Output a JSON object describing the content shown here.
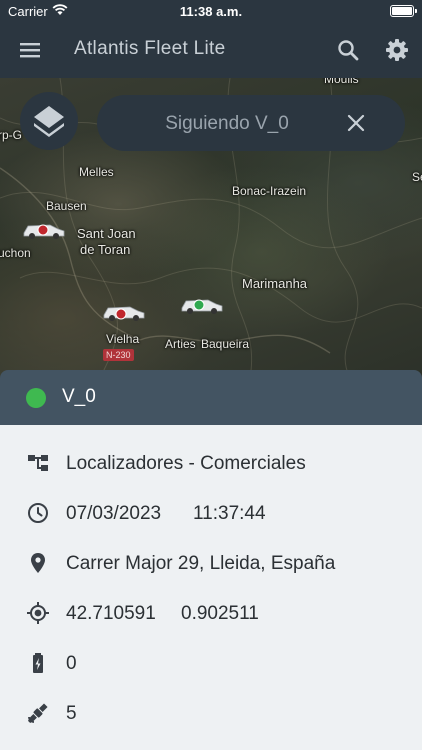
{
  "status_bar": {
    "carrier": "Carrier",
    "time": "11:38 a.m."
  },
  "app_bar": {
    "title": "Atlantis Fleet Lite"
  },
  "map": {
    "labels": {
      "moulis": "Moulis",
      "rp_g": "rp-G",
      "melles": "Melles",
      "bonac": "Bonac-Irazein",
      "se": "Se",
      "bausen": "Bausen",
      "sant_joan": "Sant Joan",
      "de_toran": "de Toran",
      "uchon": "uchon",
      "marimanha": "Marimanha",
      "vielha": "Vielha",
      "arties": "Arties",
      "baqueira": "Baqueira",
      "road": "N-230"
    }
  },
  "follow_pill": {
    "label": "Siguiendo V_0"
  },
  "vehicle_sheet": {
    "name": "V_0",
    "status_color": "#3fb950",
    "group": "Localizadores - Comerciales",
    "date": "07/03/2023",
    "time": "11:37:44",
    "address": "Carrer Major 29, Lleida, España",
    "latitude": "42.710591",
    "longitude": "0.902511",
    "battery": "0",
    "satellites": "5"
  }
}
